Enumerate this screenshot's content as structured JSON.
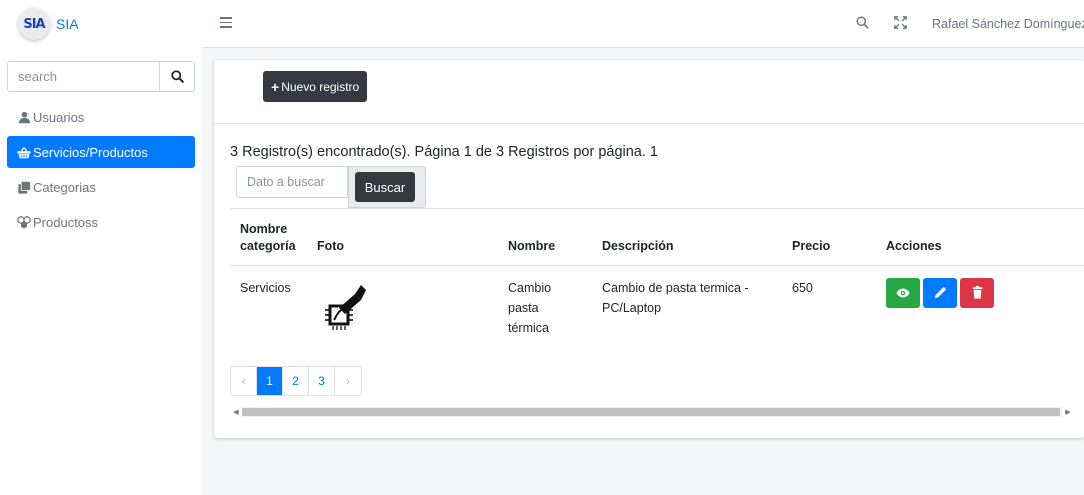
{
  "brand": {
    "logo_text": "SIA",
    "name": "SIA"
  },
  "sidebar": {
    "search_placeholder": "search",
    "items": [
      {
        "label": "Usuarios",
        "icon": "user-icon",
        "active": false
      },
      {
        "label": "Servicios/Productos",
        "icon": "shopping-basket-icon",
        "active": true
      },
      {
        "label": "Categorias",
        "icon": "clone-icon",
        "active": false
      },
      {
        "label": "Productoss",
        "icon": "cubes-icon",
        "active": false
      }
    ]
  },
  "topbar": {
    "user_name": "Rafael Sánchez Domínguez"
  },
  "toolbar": {
    "new_label": "Nuevo registro"
  },
  "summary": {
    "text": "3 Registro(s) encontrado(s). Página 1 de 3 Registros por página. 1"
  },
  "search": {
    "placeholder": "Dato a buscar",
    "button_label": "Buscar"
  },
  "table": {
    "headers": [
      "Nombre categoría",
      "Foto",
      "Nombre",
      "Descripción",
      "Precio",
      "Acciones"
    ],
    "rows": [
      {
        "categoria": "Servicios",
        "foto_icon": "thermal-paste-cpu-icon",
        "nombre": "Cambio pasta térmica",
        "descripcion": "Cambio de pasta termica - PC/Laptop",
        "precio": "650"
      }
    ]
  },
  "pagination": {
    "prev": "‹",
    "pages": [
      "1",
      "2",
      "3"
    ],
    "next": "›",
    "current": "1"
  },
  "colors": {
    "primary": "#007bff",
    "dark": "#343a40",
    "success": "#28a745",
    "danger": "#dc3545"
  }
}
